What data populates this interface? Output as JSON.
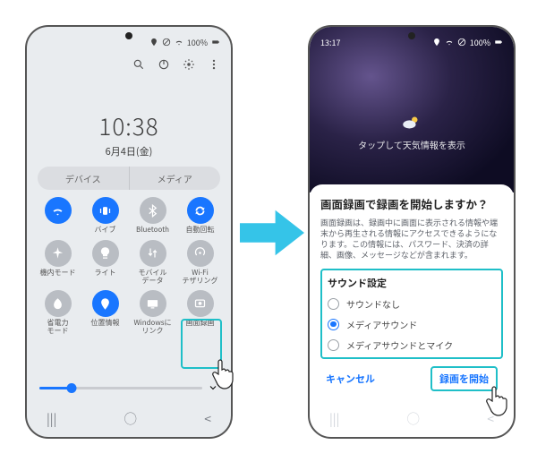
{
  "left": {
    "status": {
      "battery_text": "100%"
    },
    "clock": {
      "time": "10:38",
      "date": "6月4日(金)"
    },
    "tabs": {
      "devices": "デバイス",
      "media": "メディア"
    },
    "qs": [
      {
        "name": "wifi",
        "label": "",
        "on": true
      },
      {
        "name": "vibrate",
        "label": "バイブ",
        "on": true
      },
      {
        "name": "bluetooth",
        "label": "Bluetooth",
        "on": false
      },
      {
        "name": "autorotate",
        "label": "自動回転",
        "on": true
      },
      {
        "name": "airplane",
        "label": "機内モード",
        "on": false
      },
      {
        "name": "light",
        "label": "ライト",
        "on": false
      },
      {
        "name": "mobiledata",
        "label": "モバイル\nデータ",
        "on": false
      },
      {
        "name": "wifi-tether",
        "label": "Wi-Fi\nテザリング",
        "on": false
      },
      {
        "name": "power-save",
        "label": "省電力\nモード",
        "on": false
      },
      {
        "name": "location",
        "label": "位置情報",
        "on": true
      },
      {
        "name": "linkwin",
        "label": "Windowsに\nリンク",
        "on": false
      },
      {
        "name": "screenrec",
        "label": "画面録画",
        "on": false
      }
    ]
  },
  "right": {
    "status": {
      "time": "13:17",
      "battery_text": "100%"
    },
    "weather_tap": "タップして天気情報を表示",
    "dialog": {
      "title": "画面録画で録画を開始しますか？",
      "desc": "画面録画は、録画中に画面に表示される情報や端末から再生される情報にアクセスできるようになります。この情報には、パスワード、決済の詳細、画像、メッセージなどが含まれます。",
      "sound_title": "サウンド設定",
      "options": {
        "no_sound": "サウンドなし",
        "media": "メディアサウンド",
        "media_mic": "メディアサウンドとマイク"
      },
      "cancel": "キャンセル",
      "start": "録画を開始"
    }
  },
  "nav": {
    "recents": "|||",
    "home": "◯",
    "back": "‹"
  }
}
